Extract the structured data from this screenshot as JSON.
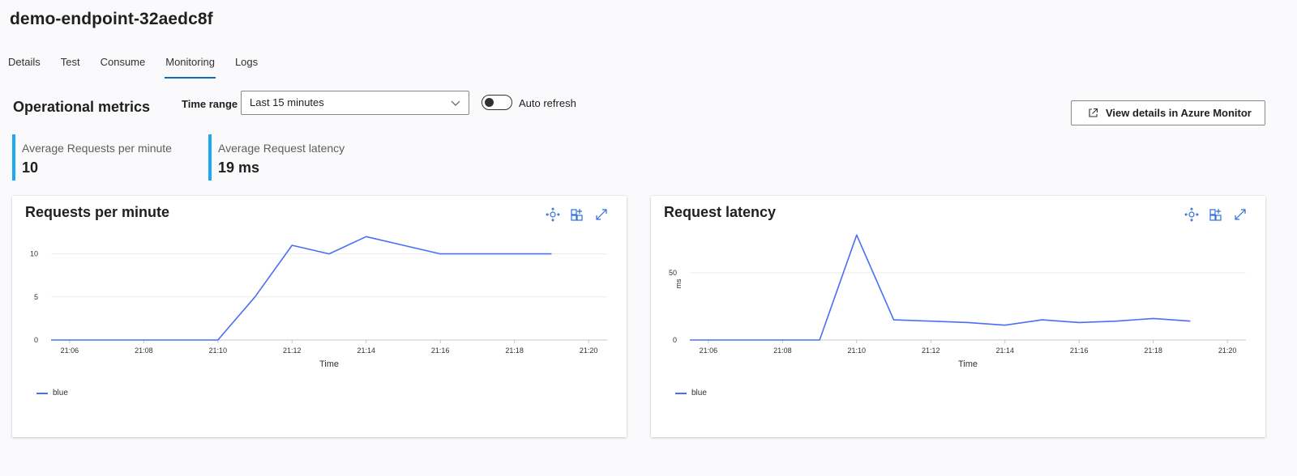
{
  "header": {
    "title": "demo-endpoint-32aedc8f"
  },
  "tabs": [
    {
      "label": "Details",
      "active": false
    },
    {
      "label": "Test",
      "active": false
    },
    {
      "label": "Consume",
      "active": false
    },
    {
      "label": "Monitoring",
      "active": true
    },
    {
      "label": "Logs",
      "active": false
    }
  ],
  "section": {
    "title": "Operational metrics",
    "time_range_label": "Time range",
    "time_range_value": "Last 15 minutes",
    "auto_refresh_label": "Auto refresh",
    "auto_refresh_on": false,
    "azure_button_label": "View details in Azure Monitor"
  },
  "stats": [
    {
      "label": "Average Requests per minute",
      "value": "10"
    },
    {
      "label": "Average Request latency",
      "value": "19 ms"
    }
  ],
  "colors": {
    "accent": "#0f6cbd",
    "stat_bar": "#1da8f2",
    "series": "#4a6ef5"
  },
  "chart_data": [
    {
      "type": "line",
      "title": "Requests per minute",
      "xlabel": "Time",
      "ylabel": "",
      "xticks": [
        "21:06",
        "21:08",
        "21:10",
        "21:12",
        "21:14",
        "21:16",
        "21:18",
        "21:20"
      ],
      "yticks": [
        0,
        5,
        10
      ],
      "xlim": [
        "21:05.5",
        "21:20.5"
      ],
      "ylim": [
        0,
        12.5
      ],
      "grid": true,
      "legend": "bottom-left",
      "series": [
        {
          "name": "blue",
          "x": [
            "21:05.5",
            "21:10",
            "21:11",
            "21:12",
            "21:13",
            "21:14",
            "21:15",
            "21:16",
            "21:17",
            "21:18",
            "21:19"
          ],
          "values": [
            0,
            0,
            5,
            11,
            10,
            12,
            11,
            10,
            10,
            10,
            10
          ]
        }
      ]
    },
    {
      "type": "line",
      "title": "Request latency",
      "xlabel": "Time",
      "ylabel": "ms",
      "xticks": [
        "21:06",
        "21:08",
        "21:10",
        "21:12",
        "21:14",
        "21:16",
        "21:18",
        "21:20"
      ],
      "yticks": [
        0,
        50
      ],
      "xlim": [
        "21:05.5",
        "21:20.5"
      ],
      "ylim": [
        0,
        80
      ],
      "grid": true,
      "legend": "bottom-left",
      "series": [
        {
          "name": "blue",
          "x": [
            "21:05.5",
            "21:09",
            "21:10",
            "21:11",
            "21:12",
            "21:13",
            "21:14",
            "21:15",
            "21:16",
            "21:17",
            "21:18",
            "21:19"
          ],
          "values": [
            0,
            0,
            78,
            15,
            14,
            13,
            11,
            15,
            13,
            14,
            16,
            14
          ]
        }
      ]
    }
  ]
}
